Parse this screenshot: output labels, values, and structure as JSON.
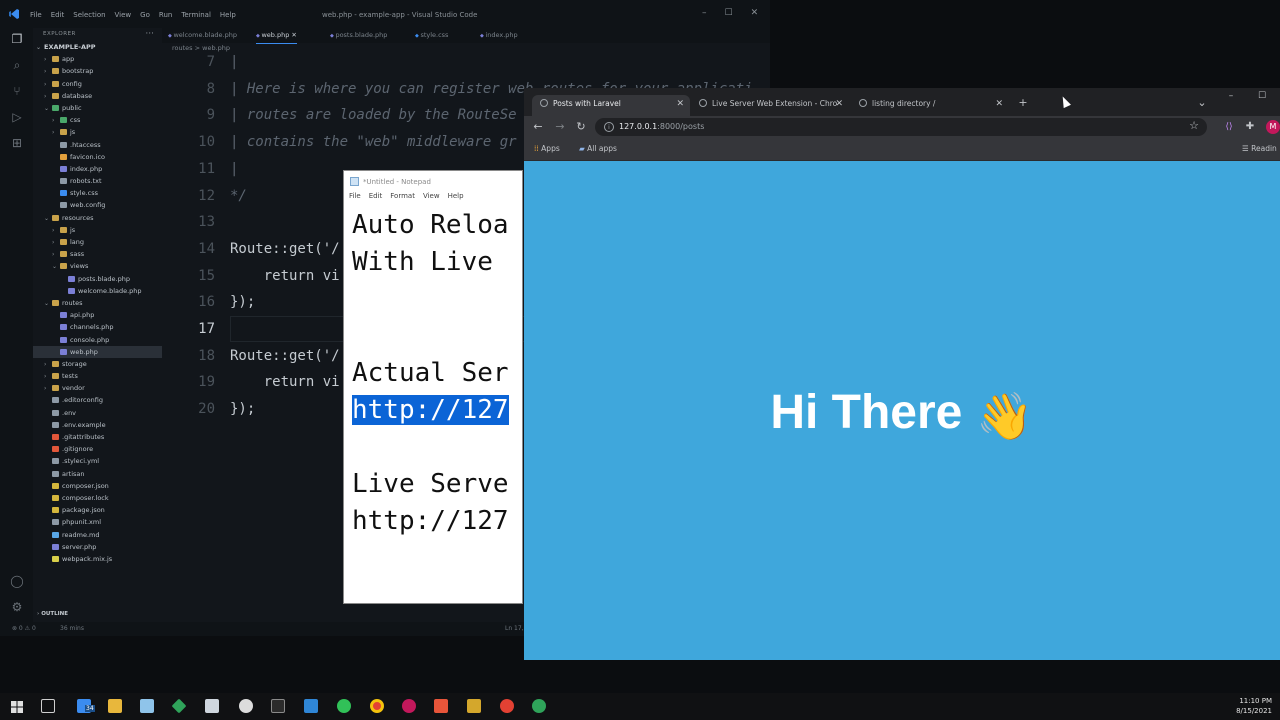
{
  "vscode": {
    "menu": [
      "File",
      "Edit",
      "Selection",
      "View",
      "Go",
      "Run",
      "Terminal",
      "Help"
    ],
    "window_title": "web.php - example-app - Visual Studio Code",
    "explorer_label": "EXPLORER",
    "project": "EXAMPLE-APP",
    "tree": [
      {
        "name": "app",
        "depth": 1,
        "kind": "folder"
      },
      {
        "name": "bootstrap",
        "depth": 1,
        "kind": "folder"
      },
      {
        "name": "config",
        "depth": 1,
        "kind": "folder"
      },
      {
        "name": "database",
        "depth": 1,
        "kind": "folder"
      },
      {
        "name": "public",
        "depth": 1,
        "kind": "folder-open"
      },
      {
        "name": "css",
        "depth": 2,
        "kind": "folder"
      },
      {
        "name": "js",
        "depth": 2,
        "kind": "folder"
      },
      {
        "name": ".htaccess",
        "depth": 2,
        "kind": "file"
      },
      {
        "name": "favicon.ico",
        "depth": 2,
        "kind": "file"
      },
      {
        "name": "index.php",
        "depth": 2,
        "kind": "file"
      },
      {
        "name": "robots.txt",
        "depth": 2,
        "kind": "file"
      },
      {
        "name": "style.css",
        "depth": 2,
        "kind": "file"
      },
      {
        "name": "web.config",
        "depth": 2,
        "kind": "file"
      },
      {
        "name": "resources",
        "depth": 1,
        "kind": "folder-open"
      },
      {
        "name": "js",
        "depth": 2,
        "kind": "folder"
      },
      {
        "name": "lang",
        "depth": 2,
        "kind": "folder"
      },
      {
        "name": "sass",
        "depth": 2,
        "kind": "folder"
      },
      {
        "name": "views",
        "depth": 2,
        "kind": "folder-open"
      },
      {
        "name": "posts.blade.php",
        "depth": 3,
        "kind": "file"
      },
      {
        "name": "welcome.blade.php",
        "depth": 3,
        "kind": "file"
      },
      {
        "name": "routes",
        "depth": 1,
        "kind": "folder-open"
      },
      {
        "name": "api.php",
        "depth": 2,
        "kind": "file"
      },
      {
        "name": "channels.php",
        "depth": 2,
        "kind": "file"
      },
      {
        "name": "console.php",
        "depth": 2,
        "kind": "file"
      },
      {
        "name": "web.php",
        "depth": 2,
        "kind": "file",
        "selected": true
      },
      {
        "name": "storage",
        "depth": 1,
        "kind": "folder"
      },
      {
        "name": "tests",
        "depth": 1,
        "kind": "folder"
      },
      {
        "name": "vendor",
        "depth": 1,
        "kind": "folder"
      },
      {
        "name": ".editorconfig",
        "depth": 1,
        "kind": "file"
      },
      {
        "name": ".env",
        "depth": 1,
        "kind": "file"
      },
      {
        "name": ".env.example",
        "depth": 1,
        "kind": "file"
      },
      {
        "name": ".gitattributes",
        "depth": 1,
        "kind": "file"
      },
      {
        "name": ".gitignore",
        "depth": 1,
        "kind": "file"
      },
      {
        "name": ".styleci.yml",
        "depth": 1,
        "kind": "file"
      },
      {
        "name": "artisan",
        "depth": 1,
        "kind": "file"
      },
      {
        "name": "composer.json",
        "depth": 1,
        "kind": "file"
      },
      {
        "name": "composer.lock",
        "depth": 1,
        "kind": "file"
      },
      {
        "name": "package.json",
        "depth": 1,
        "kind": "file"
      },
      {
        "name": "phpunit.xml",
        "depth": 1,
        "kind": "file"
      },
      {
        "name": "readme.md",
        "depth": 1,
        "kind": "file"
      },
      {
        "name": "server.php",
        "depth": 1,
        "kind": "file"
      },
      {
        "name": "webpack.mix.js",
        "depth": 1,
        "kind": "file"
      }
    ],
    "outline_label": "OUTLINE",
    "tabs": [
      "welcome.blade.php",
      "web.php",
      "posts.blade.php",
      "style.css",
      "index.php"
    ],
    "active_tab": "web.php",
    "breadcrumb": "routes > web.php",
    "status_left": "⊗ 0 ⚠ 0",
    "status_time": "36 mins",
    "status_right": "Ln 17,",
    "code_lines": [
      {
        "n": "7",
        "text": "|"
      },
      {
        "n": "8",
        "text": "| Here is where you can register web routes for your applicati"
      },
      {
        "n": "9",
        "text": "| routes are loaded by the RouteSe"
      },
      {
        "n": "10",
        "text": "| contains the \"web\" middleware gr"
      },
      {
        "n": "11",
        "text": "|"
      },
      {
        "n": "12",
        "text": "*/"
      },
      {
        "n": "13",
        "text": ""
      },
      {
        "n": "14",
        "text": "Route::get('/"
      },
      {
        "n": "15",
        "text": "    return vi"
      },
      {
        "n": "16",
        "text": "});"
      },
      {
        "n": "17",
        "text": ""
      },
      {
        "n": "18",
        "text": "Route::get('/"
      },
      {
        "n": "19",
        "text": "    return vi"
      },
      {
        "n": "20",
        "text": "});"
      }
    ],
    "current_line": "17"
  },
  "notepad": {
    "title": "*Untitled - Notepad",
    "menu": [
      "File",
      "Edit",
      "Format",
      "View",
      "Help"
    ],
    "lines": [
      "Auto Reloa",
      "With Live ",
      "",
      "",
      "Actual Ser",
      "http://127",
      "",
      "Live Serve",
      "http://127"
    ],
    "selected_line": 5
  },
  "chrome": {
    "tabs": [
      {
        "title": "Posts with Laravel",
        "active": true
      },
      {
        "title": "Live Server Web Extension - Chro",
        "active": false
      },
      {
        "title": "listing directory /",
        "active": false
      }
    ],
    "url_host": "127.0.0.1",
    "url_path": ":8000/posts",
    "bookmarks": [
      "Apps",
      "All apps"
    ],
    "reading_list": "Readin",
    "page_heading": "Hi There",
    "page_emoji": "👋",
    "avatar_letter": "M"
  },
  "taskbar": {
    "time": "11:10 PM",
    "date": "8/15/2021",
    "badge": "34"
  }
}
